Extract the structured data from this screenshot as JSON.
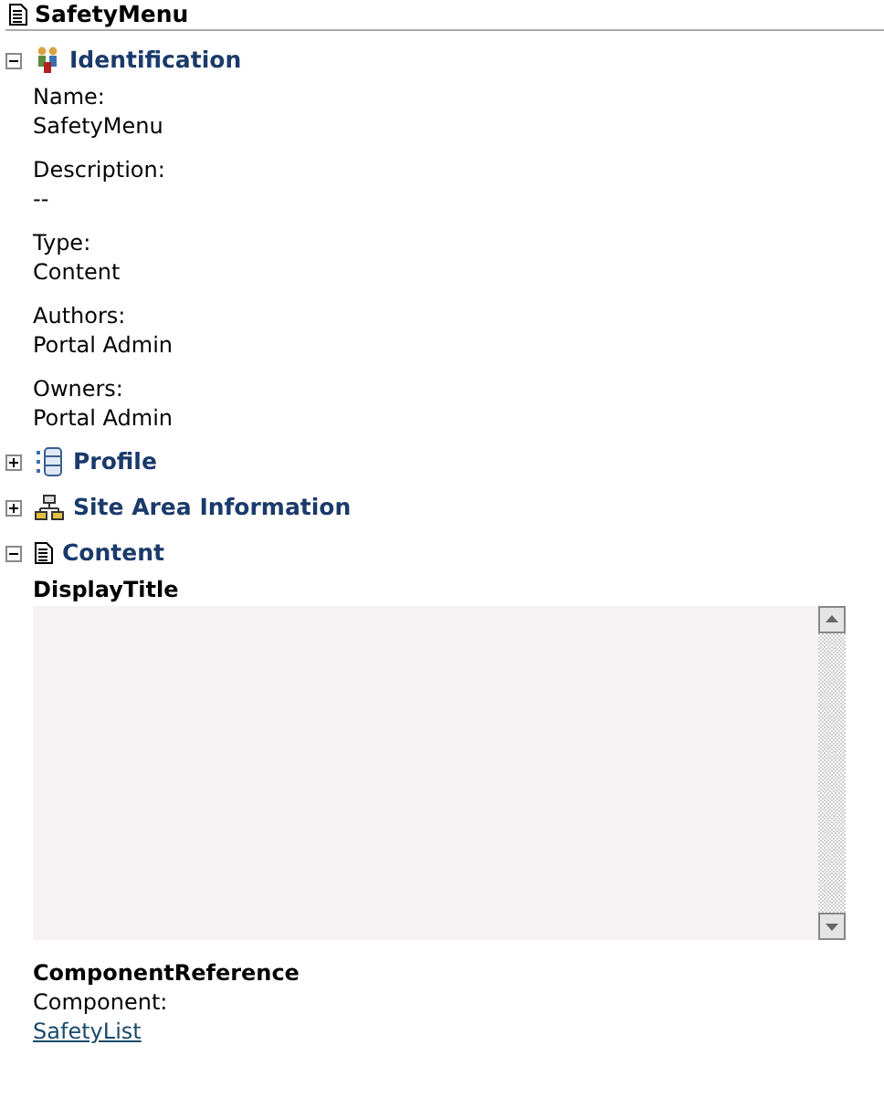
{
  "title": "SafetyMenu",
  "sections": [
    {
      "kind": "people",
      "title": "Identification",
      "expanded": true,
      "fields": [
        {
          "label": "Name:",
          "value": "SafetyMenu"
        },
        {
          "label": "Description:",
          "value": "--"
        },
        {
          "label": "Type:",
          "value": "Content"
        },
        {
          "label": "Authors:",
          "value": "Portal Admin"
        },
        {
          "label": "Owners:",
          "value": "Portal Admin"
        }
      ]
    },
    {
      "kind": "list",
      "title": "Profile",
      "expanded": false
    },
    {
      "kind": "network",
      "title": "Site Area Information",
      "expanded": false
    },
    {
      "kind": "document",
      "title": "Content",
      "expanded": true,
      "elements": [
        {
          "kind": "textarea",
          "title": "DisplayTitle"
        },
        {
          "kind": "reference",
          "title": "ComponentReference",
          "label": "Component:",
          "link": "SafetyList"
        }
      ]
    }
  ]
}
